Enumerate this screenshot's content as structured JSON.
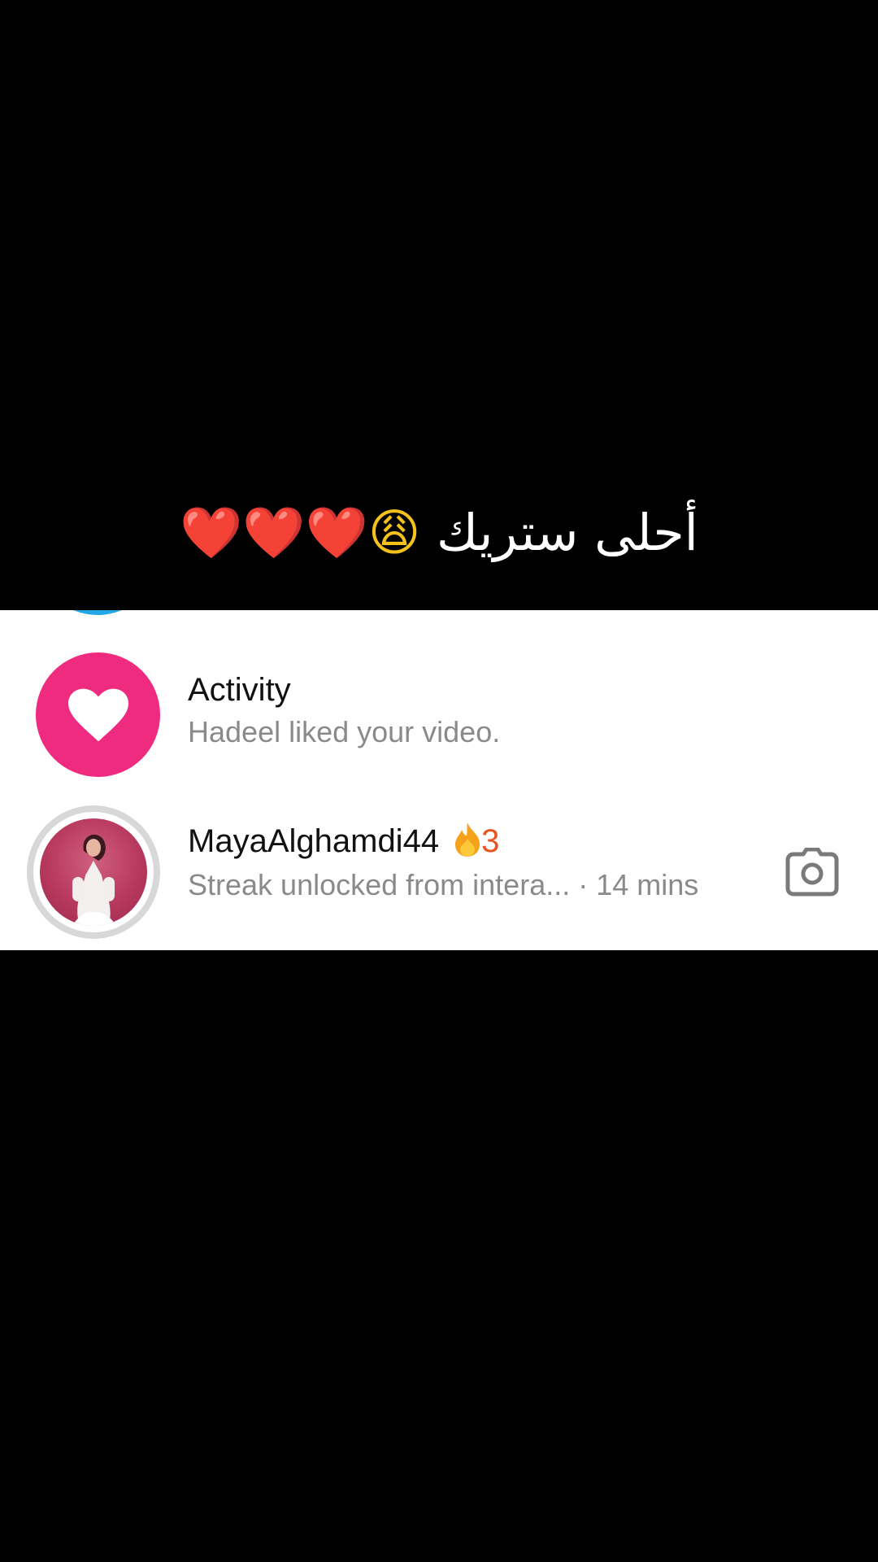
{
  "caption": {
    "text": "أحلى ستريك",
    "emoji": "😩",
    "hearts": "❤️❤️❤️"
  },
  "inbox": {
    "activity": {
      "title": "Activity",
      "subtitle": "Hadeel liked your video."
    },
    "chat": {
      "username": "MayaAlghamdi44",
      "streak_count": "3",
      "preview": "Streak unlocked from intera...",
      "time": "· 14 mins"
    }
  },
  "colors": {
    "activity_accent": "#ef2b7f",
    "streak": "#e8531e",
    "secondary_text": "#8a8a8a"
  },
  "icons": {
    "activity": "heart-icon",
    "streak": "flame-icon",
    "camera": "camera-icon"
  }
}
